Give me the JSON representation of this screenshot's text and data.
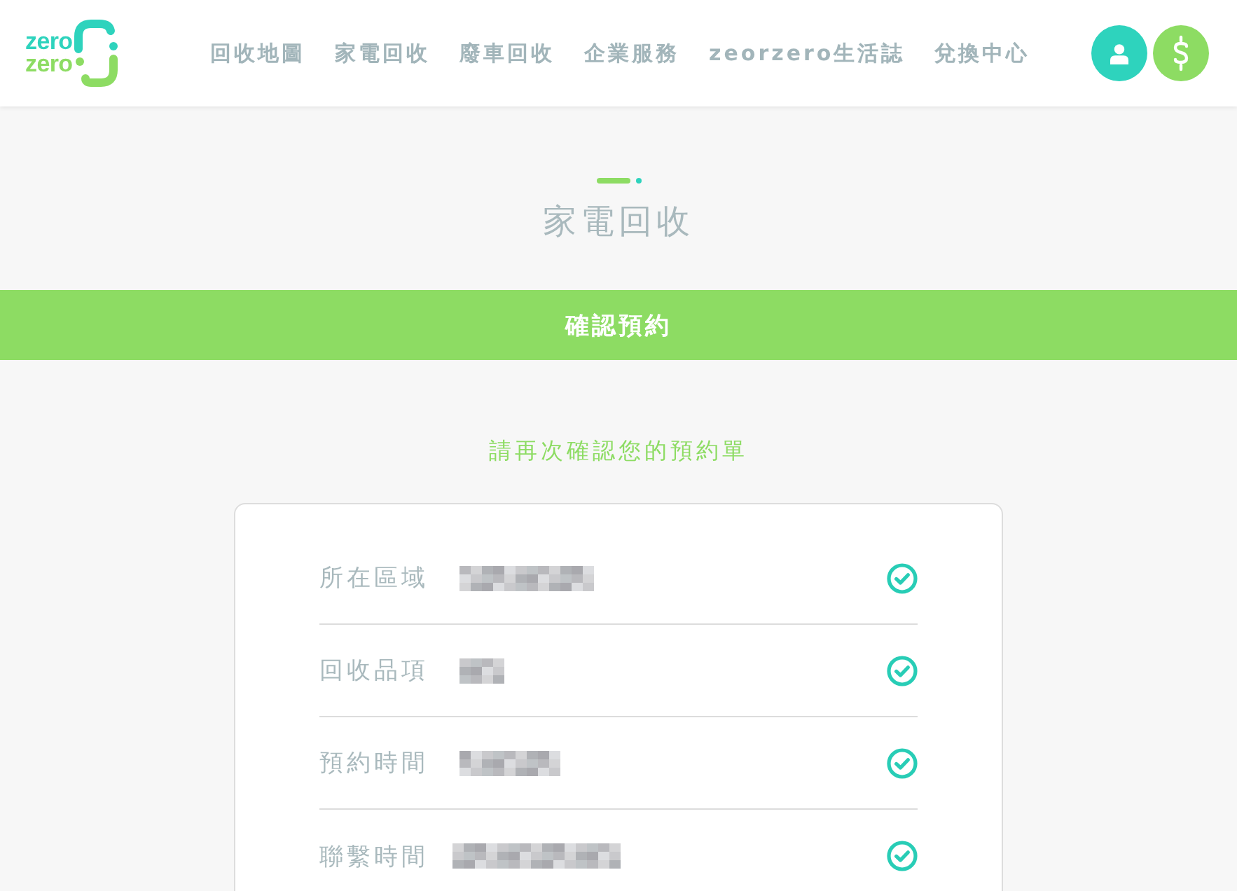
{
  "header": {
    "logo": {
      "lines": [
        "zero",
        "zero"
      ]
    },
    "nav": [
      {
        "label": "回收地圖"
      },
      {
        "label": "家電回收"
      },
      {
        "label": "廢車回收"
      },
      {
        "label": "企業服務"
      },
      {
        "label": "zeorzero生活誌"
      },
      {
        "label": "兌換中心"
      }
    ]
  },
  "page": {
    "title": "家電回收",
    "step": "確認預約",
    "prompt": "請再次確認您的預約單"
  },
  "summary": [
    {
      "label": "所在區域",
      "confirmed": true
    },
    {
      "label": "回收品項",
      "confirmed": true
    },
    {
      "label": "預約時間",
      "confirmed": true
    },
    {
      "label": "聯繫時間",
      "confirmed": true
    }
  ]
}
